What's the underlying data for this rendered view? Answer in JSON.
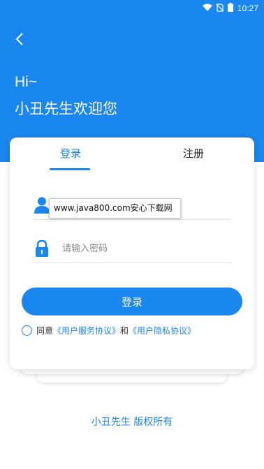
{
  "status_bar": {
    "time": "10:27"
  },
  "header": {
    "greeting": "Hi~",
    "welcome": "小丑先生欢迎您"
  },
  "tabs": [
    {
      "label": "登录",
      "active": true
    },
    {
      "label": "注册",
      "active": false
    }
  ],
  "form": {
    "username_value": "",
    "password_placeholder": "请输入密码",
    "watermark_text": "www.java800.com安心下载网",
    "login_button": "登录"
  },
  "agreement": {
    "prefix": "同意",
    "user_agreement": "《用户服务协议》",
    "conjunction": "和",
    "privacy_agreement": "《用户隐私协议》"
  },
  "footer": {
    "copyright": "小丑先生 版权所有"
  },
  "colors": {
    "primary": "#1a86f0"
  },
  "icons": [
    "wifi-icon",
    "no-sim-icon",
    "battery-icon",
    "back-chevron-icon",
    "user-icon",
    "lock-icon"
  ]
}
